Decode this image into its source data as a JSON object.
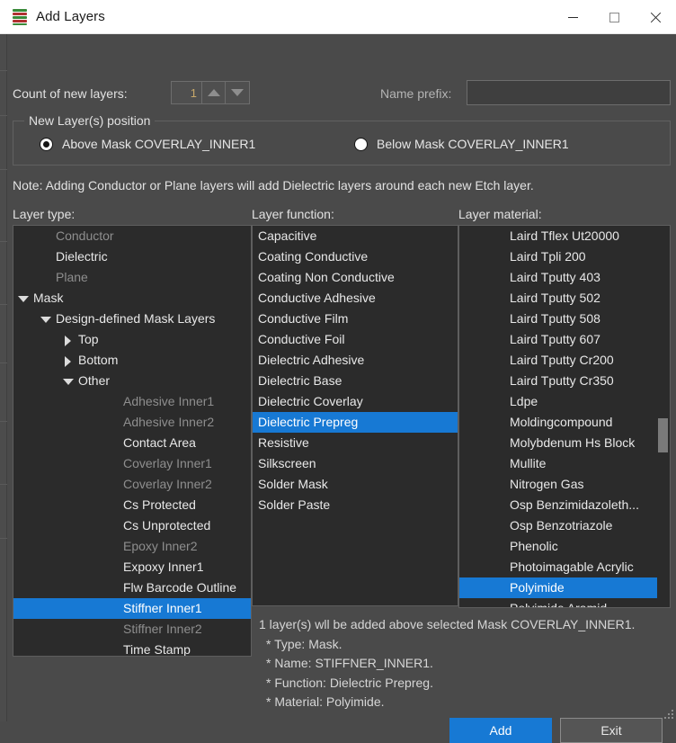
{
  "window": {
    "title": "Add Layers",
    "icon": "layers-stack-icon",
    "minimize": "minimize-icon",
    "maximize": "maximize-icon",
    "close": "close-icon"
  },
  "top": {
    "count_label": "Count of new layers:",
    "count_value": "1",
    "spin_up": "spinner-up-icon",
    "spin_down": "spinner-down-icon",
    "prefix_label": "Name prefix:",
    "prefix_value": "",
    "prefix_placeholder": ""
  },
  "position_group": {
    "title": "New Layer(s) position",
    "options": [
      {
        "label": "Above Mask COVERLAY_INNER1",
        "selected": true
      },
      {
        "label": "Below Mask COVERLAY_INNER1",
        "selected": false
      }
    ]
  },
  "note": "Note: Adding Conductor or Plane layers will add Dielectric layers around each new Etch layer.",
  "columns": {
    "type_header": "Layer type:",
    "function_header": "Layer function:",
    "material_header": "Layer material:"
  },
  "layer_type_tree": [
    {
      "label": "Conductor",
      "depth": 1,
      "arrow": "none",
      "state": "dim"
    },
    {
      "label": "Dielectric",
      "depth": 1,
      "arrow": "none",
      "state": "normal"
    },
    {
      "label": "Plane",
      "depth": 1,
      "arrow": "none",
      "state": "dim"
    },
    {
      "label": "Mask",
      "depth": 0,
      "arrow": "down",
      "state": "normal"
    },
    {
      "label": "Design-defined Mask Layers",
      "depth": 1,
      "arrow": "down",
      "state": "normal"
    },
    {
      "label": "Top",
      "depth": 2,
      "arrow": "right",
      "state": "normal"
    },
    {
      "label": "Bottom",
      "depth": 2,
      "arrow": "right",
      "state": "normal"
    },
    {
      "label": "Other",
      "depth": 2,
      "arrow": "down",
      "state": "normal"
    },
    {
      "label": "Adhesive Inner1",
      "depth": 4,
      "arrow": "none",
      "state": "dim"
    },
    {
      "label": "Adhesive Inner2",
      "depth": 4,
      "arrow": "none",
      "state": "dim"
    },
    {
      "label": "Contact Area",
      "depth": 4,
      "arrow": "none",
      "state": "normal"
    },
    {
      "label": "Coverlay Inner1",
      "depth": 4,
      "arrow": "none",
      "state": "dim"
    },
    {
      "label": "Coverlay Inner2",
      "depth": 4,
      "arrow": "none",
      "state": "dim"
    },
    {
      "label": "Cs Protected",
      "depth": 4,
      "arrow": "none",
      "state": "normal"
    },
    {
      "label": "Cs Unprotected",
      "depth": 4,
      "arrow": "none",
      "state": "normal"
    },
    {
      "label": "Epoxy Inner2",
      "depth": 4,
      "arrow": "none",
      "state": "dim"
    },
    {
      "label": "Expoxy Inner1",
      "depth": 4,
      "arrow": "none",
      "state": "normal"
    },
    {
      "label": "Flw Barcode Outline",
      "depth": 4,
      "arrow": "none",
      "state": "normal"
    },
    {
      "label": "Stiffner Inner1",
      "depth": 4,
      "arrow": "none",
      "state": "selected"
    },
    {
      "label": "Stiffner Inner2",
      "depth": 4,
      "arrow": "none",
      "state": "dim"
    },
    {
      "label": "Time Stamp",
      "depth": 4,
      "arrow": "none",
      "state": "normal"
    }
  ],
  "layer_function_list": [
    {
      "label": "Capacitive",
      "state": "normal"
    },
    {
      "label": "Coating Conductive",
      "state": "normal"
    },
    {
      "label": "Coating Non Conductive",
      "state": "normal"
    },
    {
      "label": "Conductive Adhesive",
      "state": "normal"
    },
    {
      "label": "Conductive Film",
      "state": "normal"
    },
    {
      "label": "Conductive Foil",
      "state": "normal"
    },
    {
      "label": "Dielectric Adhesive",
      "state": "normal"
    },
    {
      "label": "Dielectric Base",
      "state": "normal"
    },
    {
      "label": "Dielectric Coverlay",
      "state": "normal"
    },
    {
      "label": "Dielectric Prepreg",
      "state": "selected"
    },
    {
      "label": "Resistive",
      "state": "normal"
    },
    {
      "label": "Silkscreen",
      "state": "normal"
    },
    {
      "label": "Solder Mask",
      "state": "normal"
    },
    {
      "label": "Solder Paste",
      "state": "normal"
    }
  ],
  "layer_material_list": [
    {
      "label": "Laird Tflex Ut20000",
      "state": "normal"
    },
    {
      "label": "Laird Tpli 200",
      "state": "normal"
    },
    {
      "label": "Laird Tputty 403",
      "state": "normal"
    },
    {
      "label": "Laird Tputty 502",
      "state": "normal"
    },
    {
      "label": "Laird Tputty 508",
      "state": "normal"
    },
    {
      "label": "Laird Tputty 607",
      "state": "normal"
    },
    {
      "label": "Laird Tputty Cr200",
      "state": "normal"
    },
    {
      "label": "Laird Tputty Cr350",
      "state": "normal"
    },
    {
      "label": "Ldpe",
      "state": "normal"
    },
    {
      "label": "Moldingcompound",
      "state": "normal"
    },
    {
      "label": "Molybdenum Hs Block",
      "state": "normal"
    },
    {
      "label": "Mullite",
      "state": "normal"
    },
    {
      "label": "Nitrogen Gas",
      "state": "normal"
    },
    {
      "label": "Osp Benzimidazoleth...",
      "state": "normal"
    },
    {
      "label": "Osp Benzotriazole",
      "state": "normal"
    },
    {
      "label": "Phenolic",
      "state": "normal"
    },
    {
      "label": "Photoimagable Acrylic",
      "state": "normal"
    },
    {
      "label": "Polyimide",
      "state": "selected"
    },
    {
      "label": "Polyimide Aramid",
      "state": "normal"
    }
  ],
  "info": {
    "line1": "1 layer(s) wll be added above selected Mask COVERLAY_INNER1.",
    "line2": "* Type: Mask.",
    "line3": "* Name: STIFFNER_INNER1.",
    "line4": "* Function: Dielectric Prepreg.",
    "line5": "* Material: Polyimide."
  },
  "buttons": {
    "add": "Add",
    "exit": "Exit"
  },
  "colors": {
    "accent": "#1779d4",
    "dialog_bg": "#4a4a4a",
    "list_bg": "#2b2b2b",
    "text": "#e8e8e8",
    "text_disabled": "#8e8e8e",
    "spin_value": "#c8a86a"
  }
}
